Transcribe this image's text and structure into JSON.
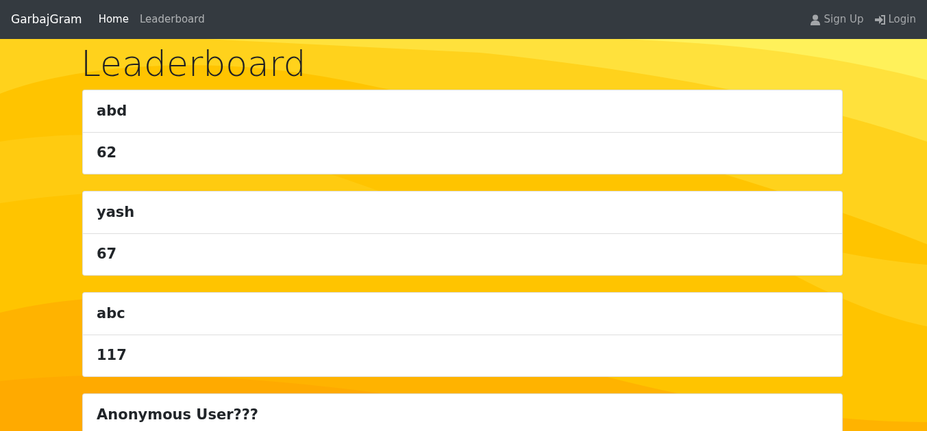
{
  "navbar": {
    "brand": "GarbajGram",
    "links": [
      {
        "label": "Home",
        "selected": true
      },
      {
        "label": "Leaderboard",
        "selected": false
      }
    ],
    "right_links": [
      {
        "label": "Sign Up",
        "kind": "user"
      },
      {
        "label": "Login",
        "kind": "login"
      }
    ]
  },
  "heading": "Leaderboard",
  "entries": [
    {
      "name": "abd",
      "score": "62"
    },
    {
      "name": "yash",
      "score": "67"
    },
    {
      "name": "abc",
      "score": "117"
    },
    {
      "name": "Anonymous User???"
    }
  ]
}
